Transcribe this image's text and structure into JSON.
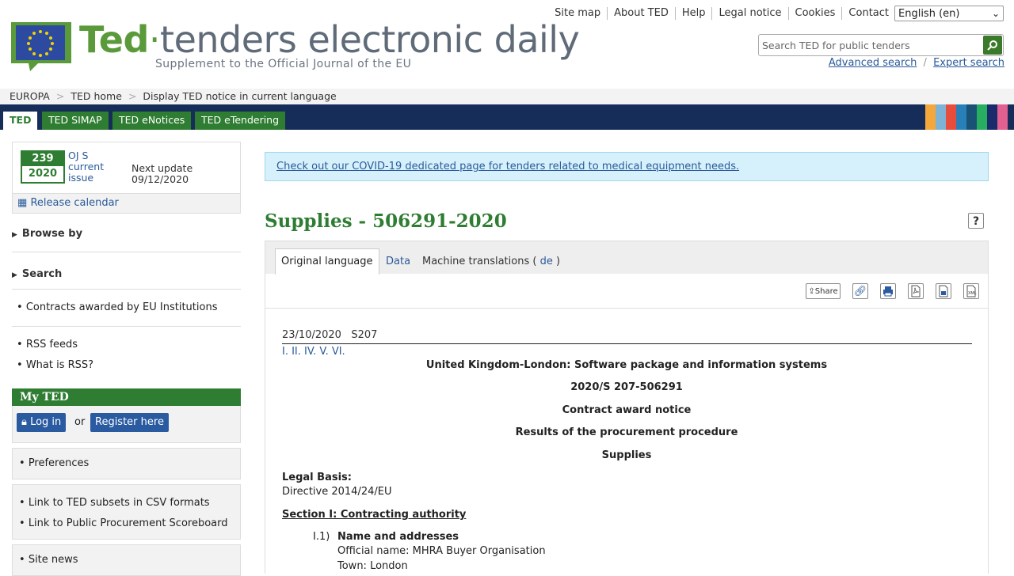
{
  "header": {
    "brand_ted": "Ted",
    "brand_dot": "·",
    "brand_rest": "tenders electronic daily",
    "subtitle": "Supplement to the Official Journal of the EU",
    "top_links": [
      "Site map",
      "About TED",
      "Help",
      "Legal notice",
      "Cookies",
      "Contact"
    ],
    "language": "English (en)",
    "search_placeholder": "Search TED for public tenders",
    "advanced_search": "Advanced search",
    "expert_search": "Expert search"
  },
  "breadcrumb": [
    "EUROPA",
    "TED home",
    "Display TED notice in current language"
  ],
  "nav_tabs": [
    "TED",
    "TED SIMAP",
    "TED eNotices",
    "TED eTendering"
  ],
  "colors": {
    "green": "#2e7d32",
    "navy": "#152d58",
    "link": "#2a5a9a",
    "stripes": [
      "#f4a73b",
      "#7fb3d5",
      "#e74c3c",
      "#2980b9",
      "#1a5276",
      "#27ae60",
      "#1b2a6b",
      "#e06090"
    ]
  },
  "sidebar": {
    "oj_number": "239",
    "oj_year": "2020",
    "oj_label": "OJ S current issue",
    "next_update_label": "Next update",
    "next_update_date": "09/12/2020",
    "release_calendar": "Release calendar",
    "browse_by": "Browse by",
    "search": "Search",
    "contracts": "Contracts awarded by EU Institutions",
    "rss_feeds": "RSS feeds",
    "what_is_rss": "What is RSS?",
    "my_ted": "My TED",
    "log_in": "Log in",
    "or": "or",
    "register": "Register here",
    "preferences": "Preferences",
    "csv_link": "Link to TED subsets in CSV formats",
    "scoreboard_link": "Link to Public Procurement Scoreboard",
    "site_news": "Site news"
  },
  "main": {
    "covid_banner": "Check out our COVID-19 dedicated page for tenders related to medical equipment needs.",
    "title": "Supplies - 506291-2020",
    "help": "?",
    "tabs": {
      "original": "Original language",
      "data": "Data",
      "machine": "Machine translations (",
      "machine_lang": "de",
      "machine_close": ")"
    },
    "share": "Share",
    "notice": {
      "date": "23/10/2020",
      "series": "S207",
      "section_links": "I.  II.  IV.  V.  VI.",
      "heading": "United Kingdom-London: Software package and information systems",
      "ref": "2020/S 207-506291",
      "type": "Contract award notice",
      "results": "Results of the procurement procedure",
      "supplies": "Supplies",
      "legal_basis_label": "Legal Basis:",
      "legal_basis": "Directive 2014/24/EU",
      "section1": "Section I: Contracting authority",
      "i1_num": "I.1)",
      "i1_title": "Name and addresses",
      "official_name": "Official name: MHRA Buyer Organisation",
      "town": "Town: London"
    }
  }
}
